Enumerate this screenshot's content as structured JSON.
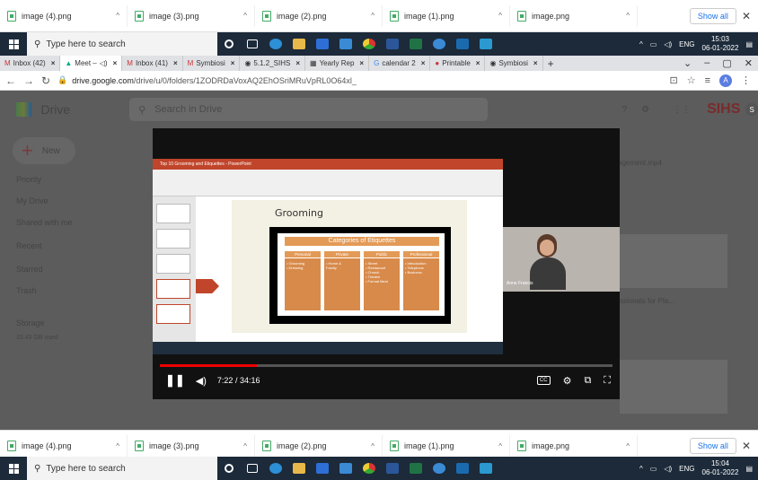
{
  "top_shelf": {
    "items": [
      "image (4).png",
      "image (3).png",
      "image (2).png",
      "image (1).png",
      "image.png"
    ],
    "show_all": "Show all"
  },
  "top_taskbar": {
    "search_placeholder": "Type here to search",
    "lang": "ENG",
    "time": "15:03",
    "date": "06-01-2022"
  },
  "tabs": [
    {
      "label": "Inbox (42)",
      "active": false
    },
    {
      "label": "Meet –",
      "active": true
    },
    {
      "label": "Inbox (41)",
      "active": false
    },
    {
      "label": "Symbiosi",
      "active": false
    },
    {
      "label": "5.1.2_SIHS",
      "active": false
    },
    {
      "label": "Yearly Rep",
      "active": false
    },
    {
      "label": "calendar 2",
      "active": false
    },
    {
      "label": "Printable",
      "active": false
    },
    {
      "label": "Symbiosi",
      "active": false
    }
  ],
  "address": {
    "url_host": "drive.google.com",
    "url_path": "/drive/u/0/folders/1ZODRDaVoxAQ2EhOSriMRuVpRL0O64xl_"
  },
  "drive": {
    "app_name": "Drive",
    "search_placeholder": "Search in Drive",
    "new_label": "New",
    "brand": "SIHS",
    "brand_initial": "S",
    "nav": [
      "Priority",
      "My Drive",
      "Shared with me",
      "Recent",
      "Starred",
      "Trash",
      "Storage"
    ],
    "storage_used": "15.43 GB used",
    "file_title": "agement.mp4",
    "side_caption": "ssionals for Pla..."
  },
  "slide": {
    "title": "Grooming",
    "category_header": "Categories of Etiquettes",
    "columns": [
      {
        "name": "Personal",
        "items": [
          "• Grooming",
          "• Dressing"
        ]
      },
      {
        "name": "Private",
        "items": [
          "• Home &",
          "  Family"
        ]
      },
      {
        "name": "Public",
        "items": [
          "• Street",
          "• Restaurant",
          "• Church",
          "• Theatre",
          "• Formal Meal"
        ]
      },
      {
        "name": "Professional",
        "items": [
          "• Introduction",
          "• Telephone",
          "• Business"
        ]
      }
    ],
    "ppt_title": "Top 10 Grooming and Etiquettes - PowerPoint"
  },
  "player": {
    "time": "7:22 / 34:16",
    "progress": 0.215,
    "presenter": "Anne Francis"
  },
  "bottom_shelf": {
    "items": [
      "image (4).png",
      "image (3).png",
      "image (2).png",
      "image (1).png",
      "image.png"
    ],
    "show_all": "Show all"
  },
  "bottom_taskbar": {
    "search_placeholder": "Type here to search",
    "lang": "ENG",
    "time": "15:04",
    "date": "06-01-2022"
  },
  "colors": {
    "accent": "#c0452a",
    "progress": "#e00000",
    "orange": "#e39a57"
  }
}
